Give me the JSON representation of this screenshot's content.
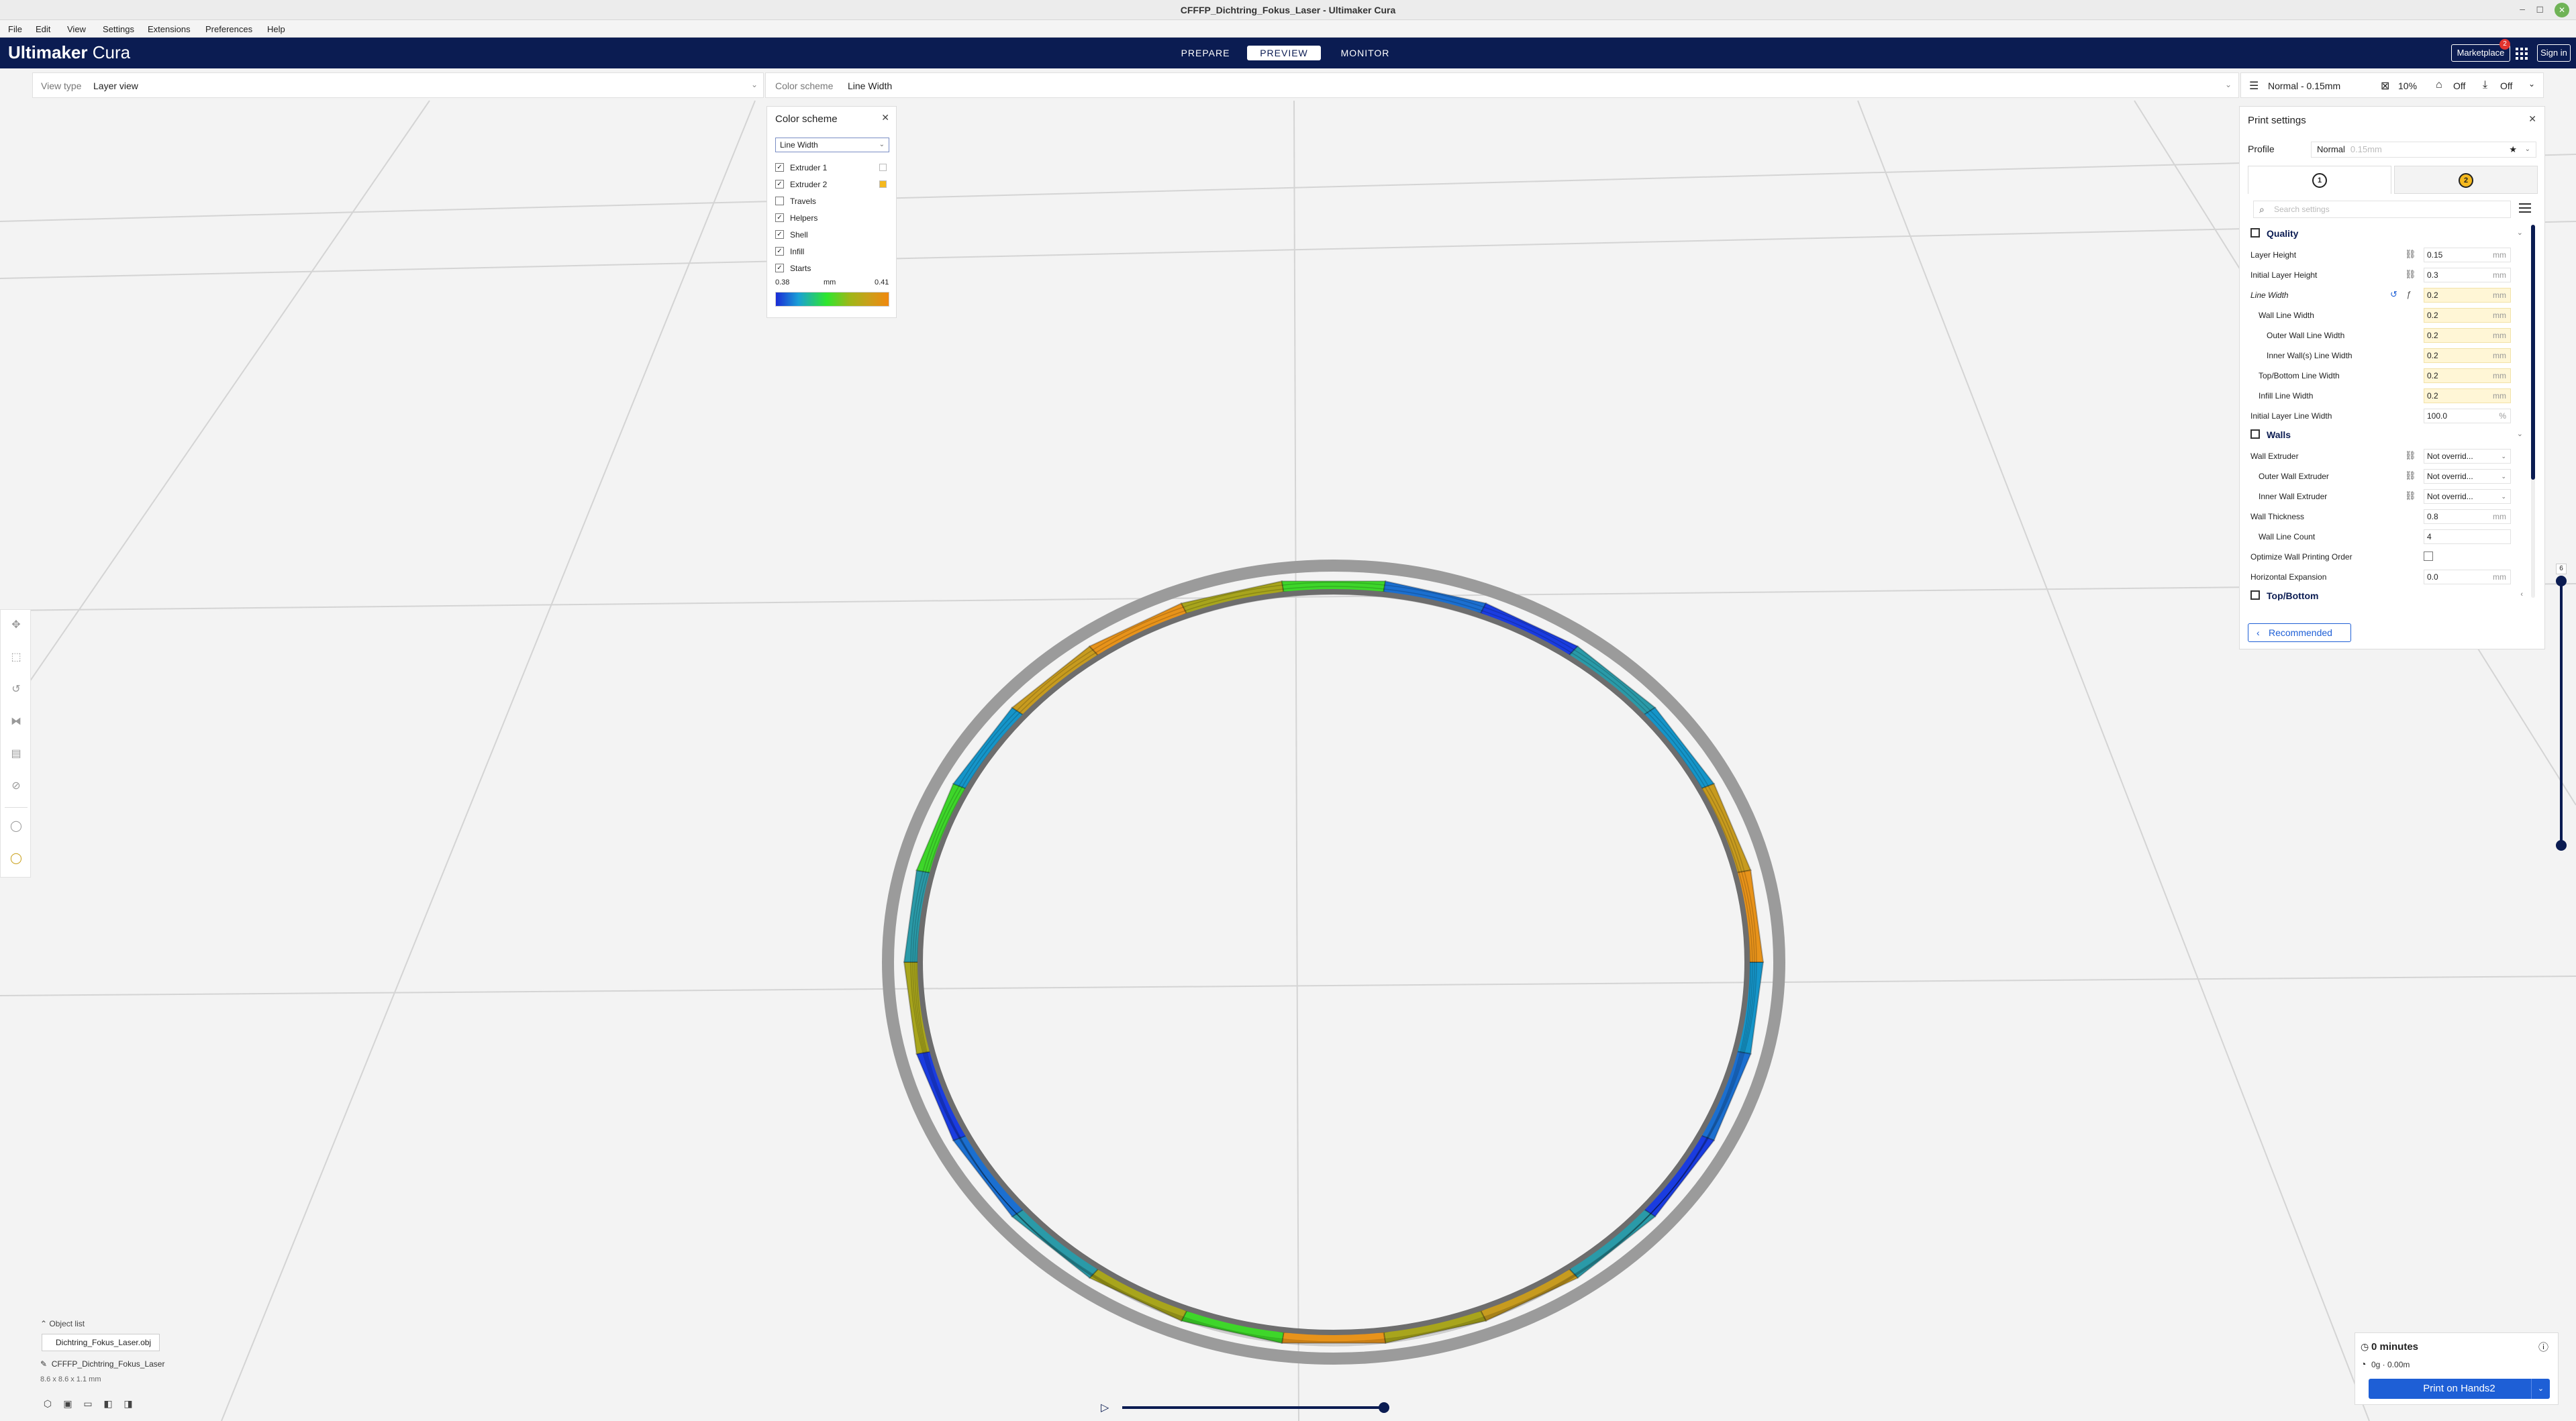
{
  "window": {
    "title": "CFFFP_Dichtring_Fokus_Laser - Ultimaker Cura"
  },
  "menu": [
    "File",
    "Edit",
    "View",
    "Settings",
    "Extensions",
    "Preferences",
    "Help"
  ],
  "header": {
    "logo_brand": "Ultimaker",
    "logo_product": "Cura",
    "stages": [
      "PREPARE",
      "PREVIEW",
      "MONITOR"
    ],
    "active_stage": "PREVIEW",
    "marketplace": "Marketplace",
    "marketplace_badge": "2",
    "sign_in": "Sign in"
  },
  "viewbar": {
    "view_type_label": "View type",
    "view_type_value": "Layer view",
    "color_scheme_label": "Color scheme",
    "color_scheme_value": "Line Width"
  },
  "printbar": {
    "profile": "Normal - 0.15mm",
    "infill": "10%",
    "support": "Off",
    "adhesion": "Off"
  },
  "color_scheme_panel": {
    "title": "Color scheme",
    "selected": "Line Width",
    "items": [
      {
        "label": "Extruder 1",
        "checked": true,
        "swatch": "#ffffff"
      },
      {
        "label": "Extruder 2",
        "checked": true,
        "swatch": "#f5b91e"
      },
      {
        "label": "Travels",
        "checked": false
      },
      {
        "label": "Helpers",
        "checked": true
      },
      {
        "label": "Shell",
        "checked": true
      },
      {
        "label": "Infill",
        "checked": true
      },
      {
        "label": "Starts",
        "checked": true
      }
    ],
    "legend_min": "0.38",
    "legend_unit": "mm",
    "legend_max": "0.41"
  },
  "print_settings": {
    "title": "Print settings",
    "profile_label": "Profile",
    "profile_value": "Normal",
    "profile_sub": "0.15mm",
    "extruder_tabs": [
      "1",
      "2"
    ],
    "search_placeholder": "Search settings",
    "quality": {
      "title": "Quality",
      "rows": [
        {
          "name": "Layer Height",
          "value": "0.15",
          "unit": "mm",
          "linked": true,
          "overridden": false
        },
        {
          "name": "Initial Layer Height",
          "value": "0.3",
          "unit": "mm",
          "linked": true,
          "overridden": false
        },
        {
          "name": "Line Width",
          "value": "0.2",
          "unit": "mm",
          "linked": false,
          "overridden": true
        },
        {
          "name": "Wall Line Width",
          "value": "0.2",
          "unit": "mm",
          "overridden": true
        },
        {
          "name": "Outer Wall Line Width",
          "value": "0.2",
          "unit": "mm",
          "overridden": true
        },
        {
          "name": "Inner Wall(s) Line Width",
          "value": "0.2",
          "unit": "mm",
          "overridden": true
        },
        {
          "name": "Top/Bottom Line Width",
          "value": "0.2",
          "unit": "mm",
          "overridden": true
        },
        {
          "name": "Infill Line Width",
          "value": "0.2",
          "unit": "mm",
          "overridden": true
        },
        {
          "name": "Initial Layer Line Width",
          "value": "100.0",
          "unit": "%",
          "overridden": false
        }
      ]
    },
    "walls": {
      "title": "Walls",
      "rows": [
        {
          "name": "Wall Extruder",
          "value": "Not overrid..."
        },
        {
          "name": "Outer Wall Extruder",
          "value": "Not overrid..."
        },
        {
          "name": "Inner Wall Extruder",
          "value": "Not overrid..."
        },
        {
          "name": "Wall Thickness",
          "value": "0.8",
          "unit": "mm"
        },
        {
          "name": "Wall Line Count",
          "value": "4"
        },
        {
          "name": "Optimize Wall Printing Order",
          "checked": false
        },
        {
          "name": "Horizontal Expansion",
          "value": "0.0",
          "unit": "mm"
        }
      ]
    },
    "top_bottom": {
      "title": "Top/Bottom"
    },
    "recommended": "Recommended"
  },
  "layer_slider": {
    "current_layer": "6"
  },
  "object_list": {
    "header": "Object list",
    "item": "Dichtring_Fokus_Laser.obj",
    "job_name": "CFFFP_Dichtring_Fokus_Laser",
    "dimensions": "8.6 x 8.6 x 1.1 mm"
  },
  "action_panel": {
    "time": "0 minutes",
    "material": "0g · 0.00m",
    "print_button": "Print on Hands2"
  },
  "colors": {
    "header_bg": "#0b1c52",
    "accent_blue": "#1e5fd6",
    "override_yellow": "#fff6d6",
    "extruder2": "#f5b91e"
  },
  "ring_segment_colors": [
    "#e8931a",
    "#1b6fd0",
    "#3ed62a",
    "#a8a51c",
    "#c79b1f",
    "#2a9aa8",
    "#1a3ce0",
    "#1595c9"
  ]
}
